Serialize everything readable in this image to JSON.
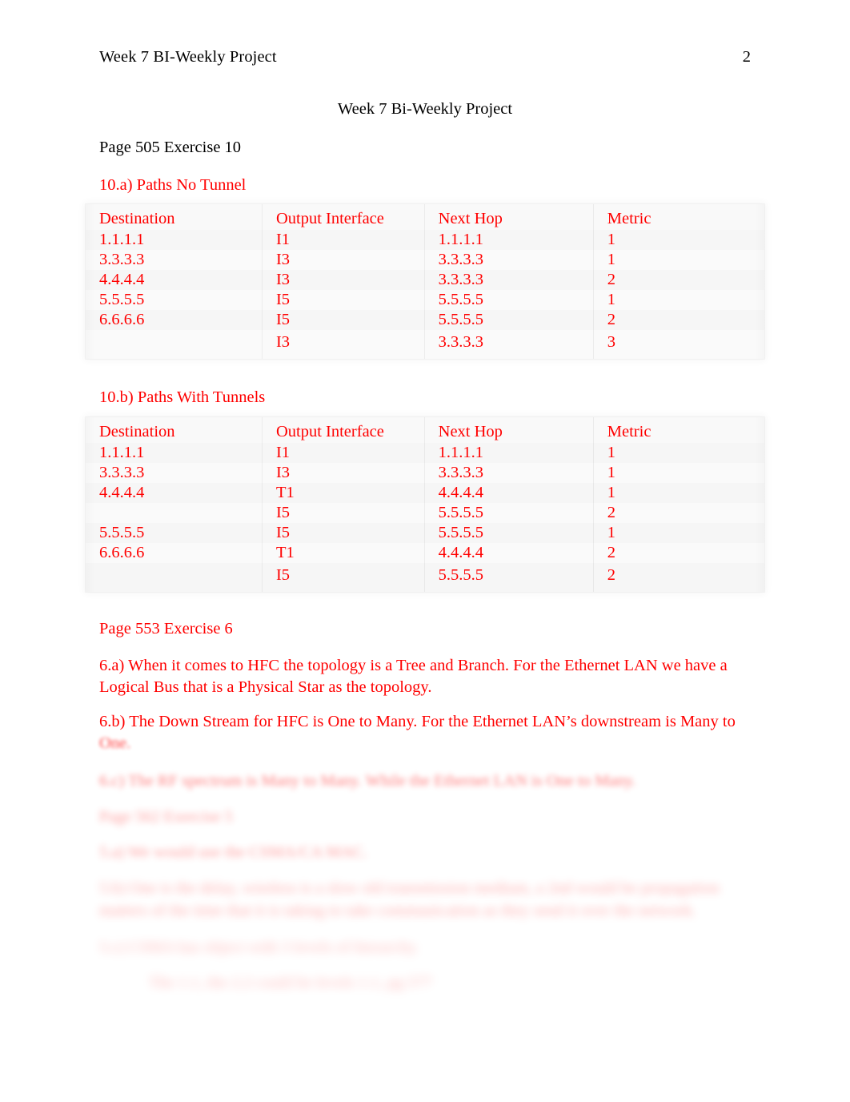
{
  "header": {
    "left_text": "Week 7 BI-Weekly Project",
    "page_number": "2"
  },
  "title": "Week 7 Bi-Weekly Project",
  "sections": {
    "exercise10_heading": "Page 505 Exercise 10",
    "part_a_heading": "10.a) Paths No Tunnel",
    "part_b_heading": "10.b) Paths With Tunnels",
    "exercise6_heading": "Page 553 Exercise 6",
    "answer_6a": "6.a) When it comes to HFC the topology is a Tree and Branch. For the Ethernet LAN we have a Logical Bus that is a Physical Star as the topology.",
    "answer_6b": "6.b) The Down Stream for HFC is One to Many. For the Ethernet LAN’s downstream is Many to",
    "answer_6b_continuation": "One."
  },
  "table_a": {
    "columns": [
      "Destination",
      "Output Interface",
      "Next Hop",
      "Metric"
    ],
    "rows": [
      [
        "1.1.1.1",
        "I1",
        "1.1.1.1",
        "1"
      ],
      [
        "3.3.3.3",
        "I3",
        "3.3.3.3",
        "1"
      ],
      [
        "4.4.4.4",
        "I3",
        "3.3.3.3",
        "2"
      ],
      [
        "5.5.5.5",
        "I5",
        "5.5.5.5",
        "1"
      ],
      [
        "6.6.6.6",
        "I5",
        "5.5.5.5",
        "2"
      ],
      [
        "",
        "I3",
        "3.3.3.3",
        "3"
      ]
    ]
  },
  "table_b": {
    "columns": [
      "Destination",
      "Output Interface",
      "Next Hop",
      "Metric"
    ],
    "rows": [
      [
        "1.1.1.1",
        "I1",
        "1.1.1.1",
        "1"
      ],
      [
        "3.3.3.3",
        "I3",
        "3.3.3.3",
        "1"
      ],
      [
        "4.4.4.4",
        "T1",
        "4.4.4.4",
        "1"
      ],
      [
        "",
        "I5",
        "5.5.5.5",
        "2"
      ],
      [
        "5.5.5.5",
        "I5",
        "5.5.5.5",
        "1"
      ],
      [
        "6.6.6.6",
        "T1",
        "4.4.4.4",
        "2"
      ],
      [
        "",
        "I5",
        "5.5.5.5",
        "2"
      ]
    ]
  },
  "obscured": {
    "note": "Trailing lines are blurred/faded in the source image and not legible.",
    "line_1": "6.c) The RF spectrum is Many to Many. While the Ethernet LAN is One to Many.",
    "line_2": "Page 562 Exercise 5",
    "line_3": "5.a) We would use the CSMA/CA MAC.",
    "line_4": "5.b) One is the delay, wireless is a slow old transmission medium, a 2nd would be propagation",
    "line_5": "matters of the time that it is taking to take communication as they send it over the network.",
    "line_6": "5.c) CSMA has object with 3 levels of hierarchy.",
    "line_7": "The 1.1, the 2.2 could be levels 1.1, pg 577"
  },
  "colors": {
    "accent_red": "#ff0000",
    "text_black": "#000000",
    "page_background": "#ffffff"
  }
}
